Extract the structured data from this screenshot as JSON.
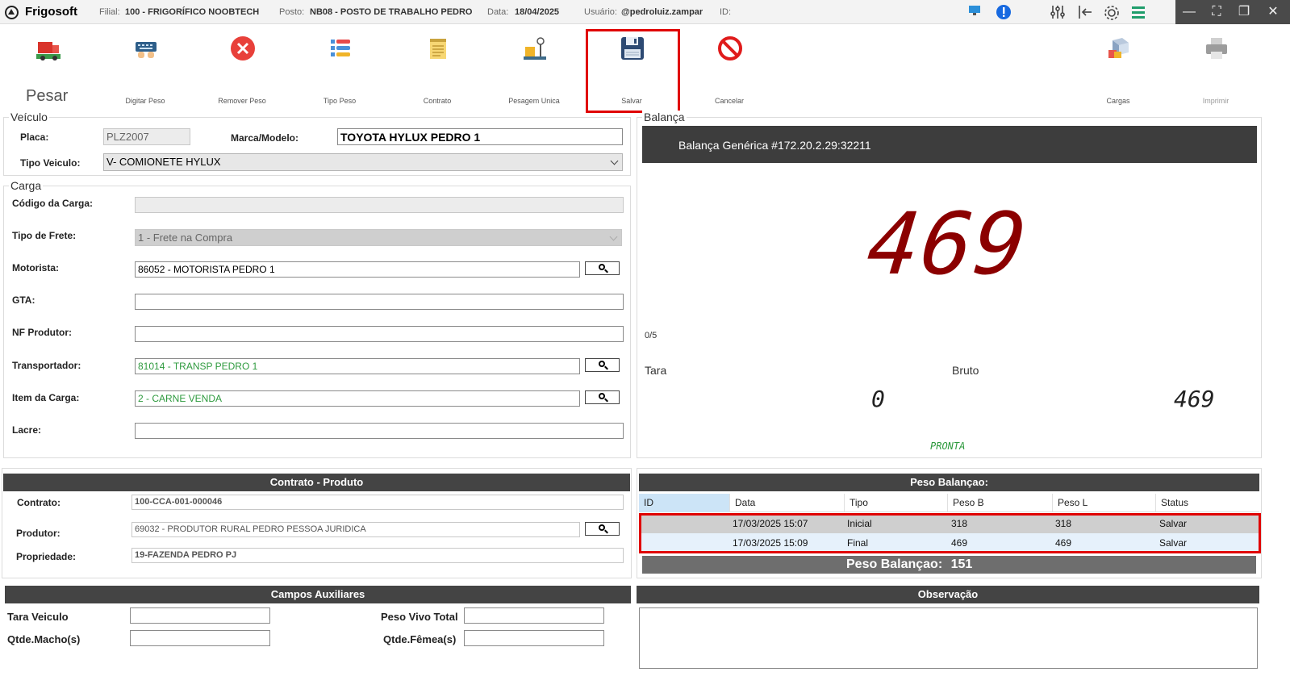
{
  "titlebar": {
    "app_title": "Frigosoft",
    "filial_label": "Filial:",
    "filial_value": "100 - FRIGORÍFICO NOOBTECH",
    "posto_label": "Posto:",
    "posto_value": "NB08 - POSTO DE TRABALHO PEDRO",
    "data_label": "Data:",
    "data_value": "18/04/2025",
    "usuario_label": "Usuário:",
    "usuario_value": "@pedroluiz.zampar",
    "id_label": "ID:"
  },
  "toolbar": {
    "pesar": "Pesar",
    "digitar_peso": "Digitar Peso",
    "remover_peso": "Remover Peso",
    "tipo_peso": "Tipo Peso",
    "contrato": "Contrato",
    "pesagem_unica": "Pesagem Unica",
    "salvar": "Salvar",
    "cancelar": "Cancelar",
    "cargas": "Cargas",
    "imprimir": "Imprimir"
  },
  "veiculo": {
    "title": "Veículo",
    "placa_label": "Placa:",
    "placa_value": "PLZ2007",
    "marca_label": "Marca/Modelo:",
    "marca_value": "TOYOTA HYLUX PEDRO 1",
    "tipo_label": "Tipo Veiculo:",
    "tipo_value": "V- COMIONETE HYLUX"
  },
  "carga": {
    "title": "Carga",
    "codigo_label": "Código da Carga:",
    "codigo_value": "",
    "frete_label": "Tipo de Frete:",
    "frete_value": "1   - Frete na Compra",
    "motorista_label": "Motorista:",
    "motorista_value": "86052 - MOTORISTA PEDRO 1",
    "gta_label": "GTA:",
    "gta_value": "",
    "nf_label": "NF Produtor:",
    "nf_value": "",
    "transportador_label": "Transportador:",
    "transportador_value": "81014 - TRANSP PEDRO 1",
    "item_label": "Item da Carga:",
    "item_value": "2 - CARNE VENDA",
    "lacre_label": "Lacre:",
    "lacre_value": ""
  },
  "balanca": {
    "title": "Balança",
    "device": "Balança Genérica  #172.20.2.29:32211",
    "display": "469",
    "counter": "0/5",
    "tara_label": "Tara",
    "bruto_label": "Bruto",
    "tara_value": "0",
    "bruto_value": "469",
    "status": "PRONTA"
  },
  "contrato": {
    "header": "Contrato - Produto",
    "contrato_label": "Contrato:",
    "contrato_value": "100-CCA-001-000046",
    "produtor_label": "Produtor:",
    "produtor_value": "69032 - PRODUTOR RURAL PEDRO PESSOA JURIDICA",
    "propriedade_label": "Propriedade:",
    "propriedade_value": "19-FAZENDA PEDRO PJ"
  },
  "peso_balanca": {
    "header": "Peso Balançao:",
    "columns": [
      "ID",
      "Data",
      "Tipo",
      "Peso B",
      "Peso L",
      "Status"
    ],
    "rows": [
      {
        "id": "",
        "data": "17/03/2025 15:07",
        "tipo": "Inicial",
        "peso_b": "318",
        "peso_l": "318",
        "status": "Salvar"
      },
      {
        "id": "",
        "data": "17/03/2025 15:09",
        "tipo": "Final",
        "peso_b": "469",
        "peso_l": "469",
        "status": "Salvar"
      }
    ],
    "total_label": "Peso Balançao:",
    "total_value": "151"
  },
  "auxiliares": {
    "header": "Campos Auxiliares",
    "tara_label": "Tara Veiculo",
    "peso_vivo_label": "Peso Vivo Total",
    "machos_label": "Qtde.Macho(s)",
    "femeas_label": "Qtde.Fêmea(s)"
  },
  "observacao": {
    "header": "Observação"
  },
  "colors": {
    "highlight": "#e00000",
    "display_red": "#8b0000",
    "green_text": "#2e9a3e",
    "dark_header": "#444444"
  }
}
